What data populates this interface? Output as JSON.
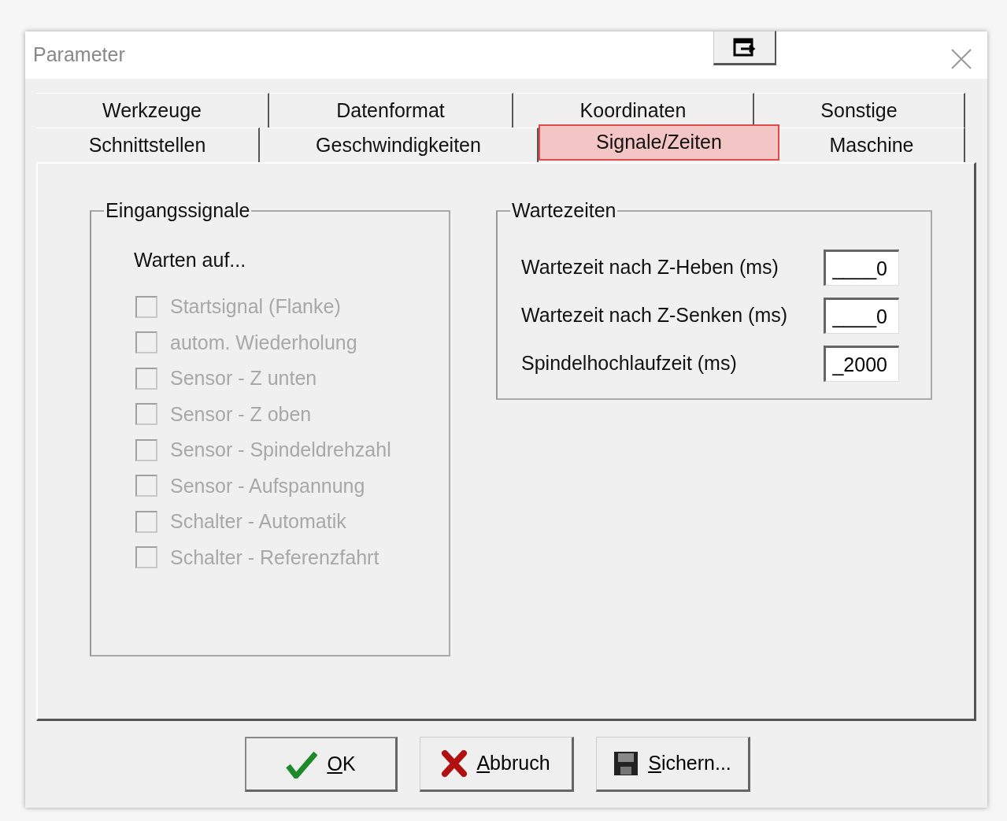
{
  "window": {
    "title": "Parameter"
  },
  "tab_rows": [
    [
      {
        "label": "Werkzeuge",
        "selected": false
      },
      {
        "label": "Datenformat",
        "selected": false
      },
      {
        "label": "Koordinaten",
        "selected": false
      },
      {
        "label": "Sonstige",
        "selected": false
      }
    ],
    [
      {
        "label": "Schnittstellen",
        "selected": false
      },
      {
        "label": "Geschwindigkeiten",
        "selected": false
      },
      {
        "label": "Signale/Zeiten",
        "selected": true
      },
      {
        "label": "Maschine",
        "selected": false
      }
    ]
  ],
  "input_signals": {
    "title": "Eingangssignale",
    "subtitle": "Warten auf...",
    "items": [
      {
        "label": "Startsignal (Flanke)",
        "checked": false,
        "disabled": true
      },
      {
        "label": "autom. Wiederholung",
        "checked": false,
        "disabled": true
      },
      {
        "label": "Sensor - Z unten",
        "checked": false,
        "disabled": true
      },
      {
        "label": "Sensor - Z oben",
        "checked": false,
        "disabled": true
      },
      {
        "label": "Sensor - Spindeldrehzahl",
        "checked": false,
        "disabled": true
      },
      {
        "label": "Sensor - Aufspannung",
        "checked": false,
        "disabled": true
      },
      {
        "label": "Schalter - Automatik",
        "checked": false,
        "disabled": true
      },
      {
        "label": "Schalter - Referenzfahrt",
        "checked": false,
        "disabled": true
      }
    ]
  },
  "wait_times": {
    "title": "Wartezeiten",
    "fields": [
      {
        "label": "Wartezeit nach Z-Heben (ms)",
        "value": "____0"
      },
      {
        "label": "Wartezeit nach Z-Senken (ms)",
        "value": "____0"
      },
      {
        "label": "Spindelhochlaufzeit (ms)",
        "value": "_2000"
      }
    ]
  },
  "buttons": [
    {
      "kind": "ok",
      "label": "OK",
      "underline_first": true
    },
    {
      "kind": "cancel",
      "label": "Abbruch",
      "underline_first": true
    },
    {
      "kind": "save",
      "label": "Sichern...",
      "underline_first": true
    }
  ]
}
